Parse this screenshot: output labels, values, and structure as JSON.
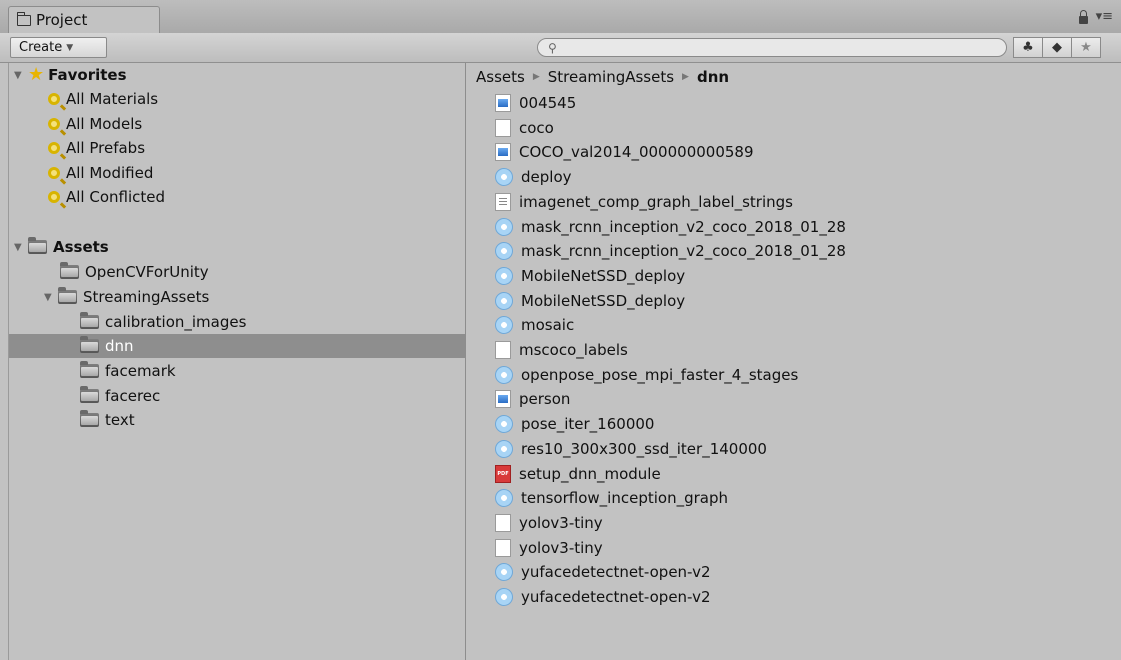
{
  "tab": {
    "title": "Project"
  },
  "toolbar": {
    "create_label": "Create",
    "search_placeholder": "",
    "icons": [
      "filter-by-type-icon",
      "filter-by-label-icon",
      "favorite-star-icon"
    ]
  },
  "favorites": {
    "label": "Favorites",
    "items": [
      "All Materials",
      "All Models",
      "All Prefabs",
      "All Modified",
      "All Conflicted"
    ]
  },
  "assets": {
    "label": "Assets",
    "children": {
      "opencv": "OpenCVForUnity",
      "streaming": "StreamingAssets",
      "sub": [
        "calibration_images",
        "dnn",
        "facemark",
        "facerec",
        "text"
      ]
    },
    "selected": "dnn"
  },
  "breadcrumb": [
    "Assets",
    "StreamingAssets",
    "dnn"
  ],
  "files": [
    {
      "name": "004545",
      "icon": "image"
    },
    {
      "name": "coco",
      "icon": "blank"
    },
    {
      "name": "COCO_val2014_000000000589",
      "icon": "image"
    },
    {
      "name": "deploy",
      "icon": "asset"
    },
    {
      "name": "imagenet_comp_graph_label_strings",
      "icon": "text"
    },
    {
      "name": "mask_rcnn_inception_v2_coco_2018_01_28",
      "icon": "asset"
    },
    {
      "name": "mask_rcnn_inception_v2_coco_2018_01_28",
      "icon": "asset"
    },
    {
      "name": "MobileNetSSD_deploy",
      "icon": "asset"
    },
    {
      "name": "MobileNetSSD_deploy",
      "icon": "asset"
    },
    {
      "name": "mosaic",
      "icon": "asset"
    },
    {
      "name": "mscoco_labels",
      "icon": "blank"
    },
    {
      "name": "openpose_pose_mpi_faster_4_stages",
      "icon": "asset"
    },
    {
      "name": "person",
      "icon": "image"
    },
    {
      "name": "pose_iter_160000",
      "icon": "asset"
    },
    {
      "name": "res10_300x300_ssd_iter_140000",
      "icon": "asset"
    },
    {
      "name": "setup_dnn_module",
      "icon": "pdf"
    },
    {
      "name": "tensorflow_inception_graph",
      "icon": "asset"
    },
    {
      "name": "yolov3-tiny",
      "icon": "blank"
    },
    {
      "name": "yolov3-tiny",
      "icon": "blank"
    },
    {
      "name": "yufacedetectnet-open-v2",
      "icon": "asset"
    },
    {
      "name": "yufacedetectnet-open-v2",
      "icon": "asset"
    }
  ]
}
